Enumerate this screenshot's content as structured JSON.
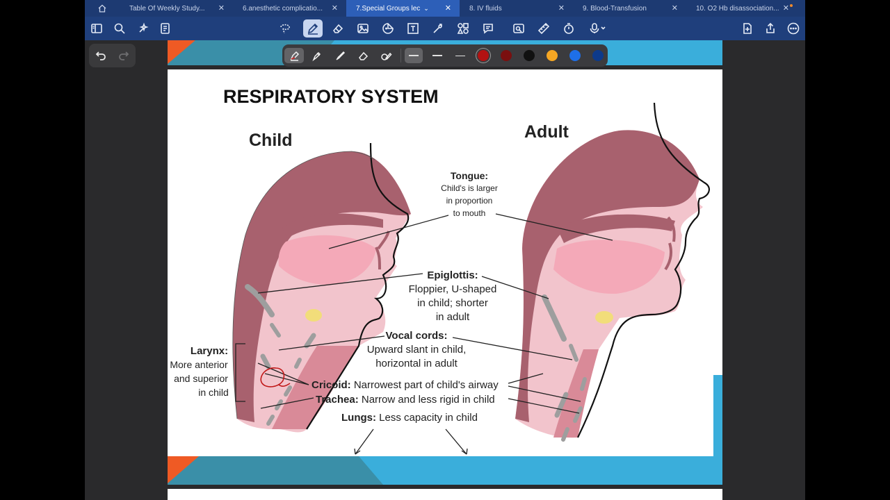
{
  "tabs": [
    {
      "label": "Table Of Weekly Study...",
      "active": false
    },
    {
      "label": "6.anesthetic complicatio...",
      "active": false
    },
    {
      "label": "7.Special Groups lec",
      "active": true
    },
    {
      "label": "8. IV fluids",
      "active": false
    },
    {
      "label": "9. Blood-Transfusion",
      "active": false
    },
    {
      "label": "10. O2 Hb disassociation...",
      "active": false
    }
  ],
  "toolbar": {
    "left_icons": [
      "sidebar-icon",
      "search-icon",
      "sparkle-icon",
      "document-list-icon"
    ],
    "center_icons": [
      "lasso-icon",
      "pen-icon",
      "eraser-icon",
      "image-icon",
      "sticker-icon",
      "text-box-icon",
      "laser-pointer-icon",
      "shapes-icon",
      "comment-icon",
      "screenshot-icon",
      "ruler-icon",
      "timer-icon",
      "microphone-icon"
    ],
    "right_icons": [
      "add-page-icon",
      "share-icon",
      "more-icon"
    ]
  },
  "pen_bar": {
    "tools": [
      "fountain-pen-icon",
      "highlighter-icon",
      "brush-icon",
      "eraser-icon",
      "shape-pen-icon"
    ],
    "colors": [
      "#b31212",
      "#7a0f0f",
      "#111111",
      "#f5a623",
      "#1e6fe8",
      "#0d3a8a"
    ],
    "selected_color": "#b31212"
  },
  "slide": {
    "title": "RESPIRATORY SYSTEM",
    "child_label": "Child",
    "adult_label": "Adult",
    "tongue": {
      "heading": "Tongue:",
      "lines": [
        "Child's is larger",
        "in proportion",
        "to mouth"
      ]
    },
    "epiglottis": {
      "heading": "Epiglottis:",
      "lines": [
        "Floppier, U-shaped",
        "in child; shorter",
        "in adult"
      ]
    },
    "vocal": {
      "heading": "Vocal cords:",
      "lines": [
        "Upward slant in child,",
        "horizontal in adult"
      ]
    },
    "larynx": {
      "heading": "Larynx:",
      "lines": [
        "More anterior",
        "and superior",
        "in child"
      ]
    },
    "cricoid": {
      "heading": "Cricoid:",
      "text": "Narrowest part of child's airway"
    },
    "trachea": {
      "heading": "Trachea:",
      "text": "Narrow and less rigid in child"
    },
    "lungs": {
      "heading": "Lungs:",
      "text": "Less capacity in child"
    }
  },
  "colors": {
    "tabbar": "#1d3a72",
    "toolbar": "#1f3f7c",
    "slide_band_light": "#3aaedb",
    "slide_band_dark": "#3a8fa8",
    "slide_accent": "#ef5a24",
    "tissue": "#a8616e",
    "pink": "#f2c4cc"
  }
}
